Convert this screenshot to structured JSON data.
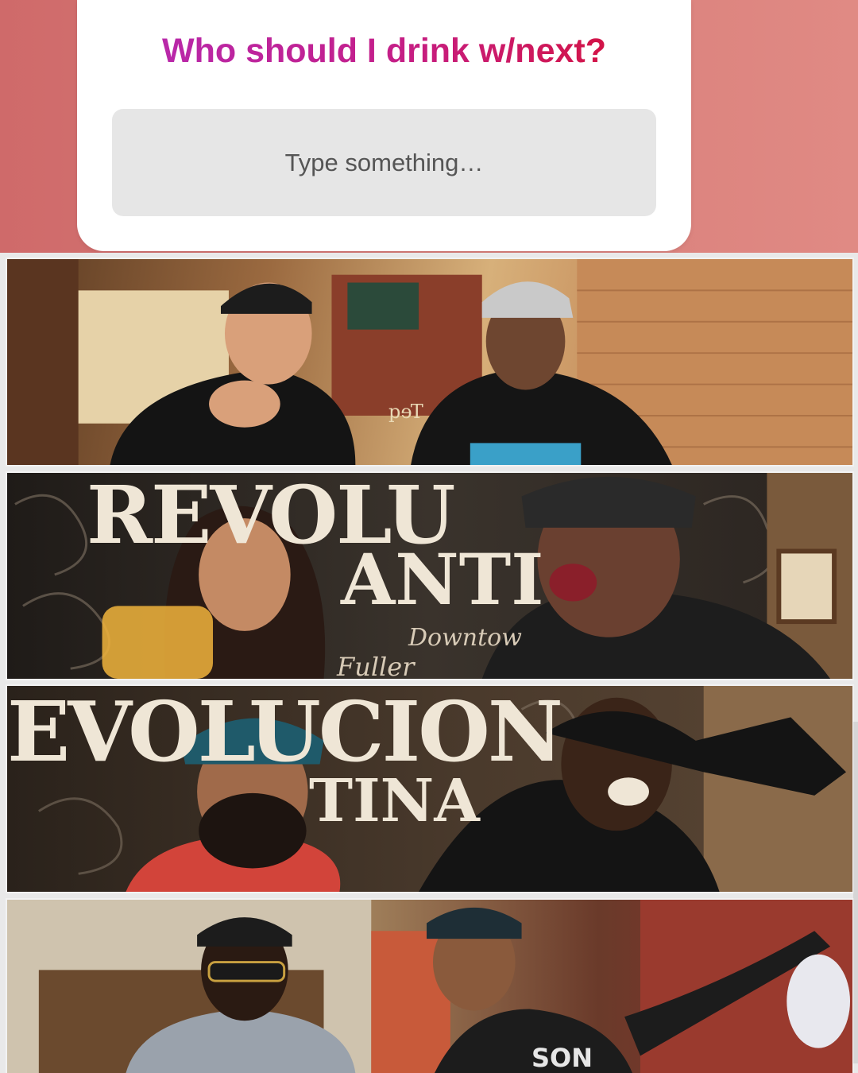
{
  "question_sticker": {
    "question": "Who should I drink w/next?",
    "input_placeholder": "Type something…",
    "gradient_colors": [
      "#b42bb5",
      "#c41f8a",
      "#d8102e"
    ]
  },
  "background_color": "#d77c78",
  "video_tiles": [
    {
      "scene": "bar-with-brick-wall"
    },
    {
      "scene": "restaurant-mural-laughing"
    },
    {
      "scene": "restaurant-mural-cheering"
    },
    {
      "scene": "bar-interior-celebrating"
    }
  ],
  "signage": {
    "sign_1": "Teq",
    "sign_2": "REVOLU",
    "sign_3": "ANTI",
    "sign_4": "Downtow",
    "sign_5": "Fuller",
    "sign_6": "EVOLUCION",
    "sign_7": "TINA",
    "hoodie": "SON"
  }
}
